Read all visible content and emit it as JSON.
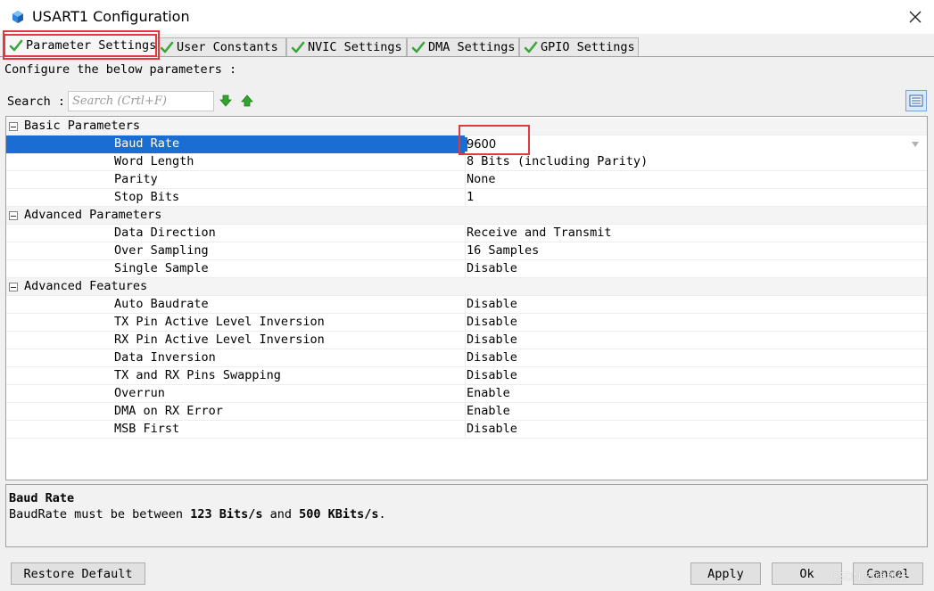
{
  "window": {
    "title": "USART1 Configuration",
    "accent_color": "#1a6ed3",
    "highlight_color": "#e0393e"
  },
  "tabs": [
    {
      "label": "Parameter Settings",
      "icon": "check-icon",
      "active": true
    },
    {
      "label": "User Constants",
      "icon": "check-icon",
      "active": false
    },
    {
      "label": "NVIC Settings",
      "icon": "check-icon",
      "active": false
    },
    {
      "label": "DMA Settings",
      "icon": "check-icon",
      "active": false
    },
    {
      "label": "GPIO Settings",
      "icon": "check-icon",
      "active": false
    }
  ],
  "configure_label": "Configure the below parameters :",
  "search": {
    "label": "Search :",
    "placeholder": "Search (Crtl+F)"
  },
  "groups": [
    {
      "name": "Basic Parameters",
      "params": [
        {
          "name": "Baud Rate",
          "value": "9600"
        },
        {
          "name": "Word Length",
          "value": "8 Bits (including Parity)"
        },
        {
          "name": "Parity",
          "value": "None"
        },
        {
          "name": "Stop Bits",
          "value": "1"
        }
      ]
    },
    {
      "name": "Advanced Parameters",
      "params": [
        {
          "name": "Data Direction",
          "value": "Receive and Transmit"
        },
        {
          "name": "Over Sampling",
          "value": "16 Samples"
        },
        {
          "name": "Single Sample",
          "value": "Disable"
        }
      ]
    },
    {
      "name": "Advanced Features",
      "params": [
        {
          "name": "Auto Baudrate",
          "value": "Disable"
        },
        {
          "name": "TX Pin Active Level Inversion",
          "value": "Disable"
        },
        {
          "name": "RX Pin Active Level Inversion",
          "value": "Disable"
        },
        {
          "name": "Data Inversion",
          "value": "Disable"
        },
        {
          "name": "TX and RX Pins Swapping",
          "value": "Disable"
        },
        {
          "name": "Overrun",
          "value": "Enable"
        },
        {
          "name": "DMA on RX Error",
          "value": "Enable"
        },
        {
          "name": "MSB First",
          "value": "Disable"
        }
      ]
    }
  ],
  "description": {
    "title": "Baud Rate",
    "text_prefix": "BaudRate must be between ",
    "min": "123 Bits/s",
    "text_mid": " and ",
    "max": "500 KBits/s",
    "text_suffix": "."
  },
  "buttons": {
    "restore_default": "Restore Default",
    "apply": "Apply",
    "ok": "Ok",
    "cancel": "Cancel"
  },
  "watermark": "CSDN @啥都行"
}
